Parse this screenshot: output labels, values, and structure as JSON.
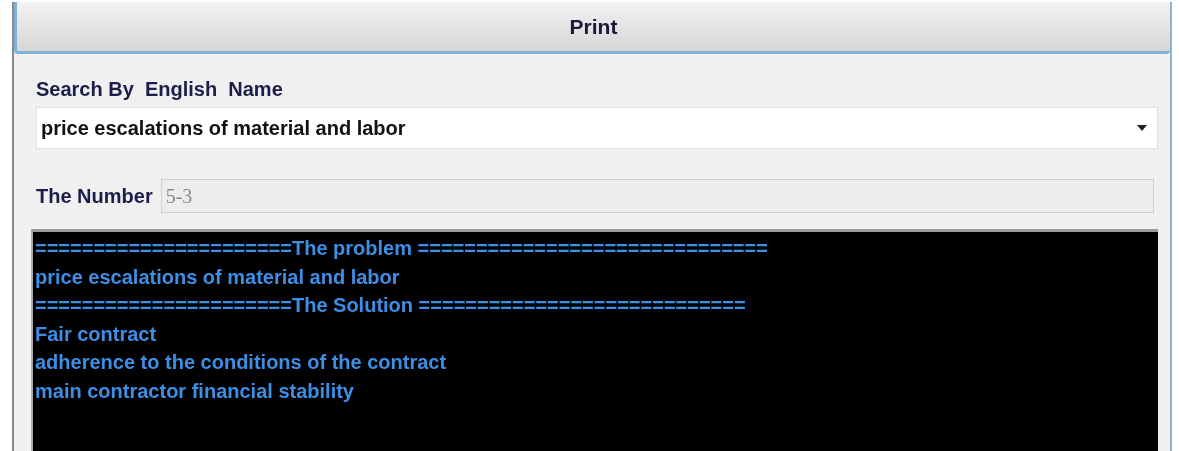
{
  "print_button": {
    "label": "Print"
  },
  "search": {
    "label": "Search By  English  Name",
    "value": "price escalations of material and labor"
  },
  "number": {
    "label": "The Number",
    "value": "5-3",
    "disabled": true
  },
  "output_lines": [
    "======================The problem ==============================",
    "price escalations of material and labor",
    "======================The Solution ============================",
    "Fair contract",
    "adherence to the conditions of the contract",
    "main contractor financial stability"
  ]
}
